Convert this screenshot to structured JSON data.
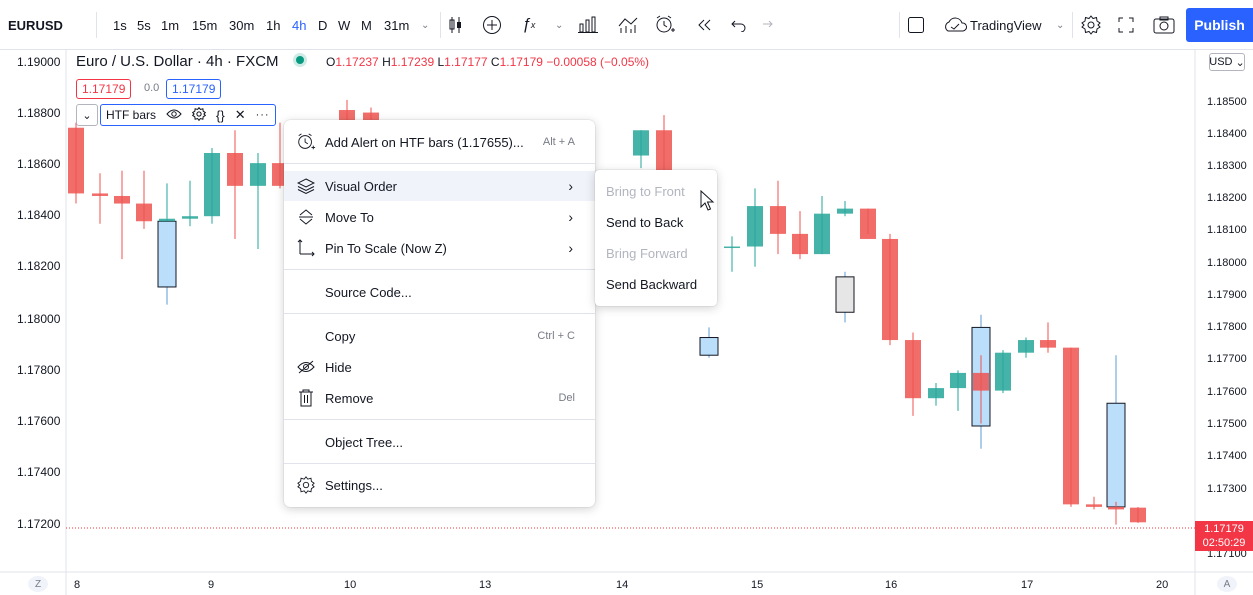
{
  "symbol": "EURUSD",
  "toolbar": {
    "intervals": [
      "1s",
      "5s",
      "1m",
      "15m",
      "30m",
      "1h",
      "4h",
      "D",
      "W",
      "M",
      "31m"
    ],
    "active_interval": "4h",
    "layout_name": "TradingView",
    "publish_label": "Publish"
  },
  "legend": {
    "title": "Euro / U.S. Dollar · 4h · FXCM",
    "open_label": "O",
    "open": "1.17237",
    "high_label": "H",
    "high": "1.17239",
    "low_label": "L",
    "low": "1.17177",
    "close_label": "C",
    "close": "1.17179",
    "change": "−0.00058 (−0.05%)",
    "sell_price": "1.17179",
    "spread": "0.0",
    "buy_price": "1.17179",
    "indicator_name": "HTF bars"
  },
  "left_axis": [
    "1.19000",
    "1.18800",
    "1.18600",
    "1.18400",
    "1.18200",
    "1.18000",
    "1.17800",
    "1.17600",
    "1.17400",
    "1.17200"
  ],
  "right_axis": [
    "1.18500",
    "1.18400",
    "1.18300",
    "1.18200",
    "1.18100",
    "1.18000",
    "1.17900",
    "1.17800",
    "1.17700",
    "1.17600",
    "1.17500",
    "1.17400",
    "1.17300",
    "1.17100"
  ],
  "right_axis_currency": "USD",
  "current_price": {
    "value": "1.17179",
    "countdown": "02:50:29"
  },
  "x_axis": [
    "8",
    "9",
    "10",
    "13",
    "14",
    "15",
    "16",
    "17",
    "20"
  ],
  "corner_left": "Z",
  "corner_right": "A",
  "context_menu": {
    "items": [
      {
        "icon": "add-alert-icon",
        "label": "Add Alert on HTF bars (1.17655)...",
        "shortcut": "Alt + A"
      },
      {
        "icon": "layers-icon",
        "label": "Visual Order",
        "submenu": true
      },
      {
        "icon": "move-to-icon",
        "label": "Move To",
        "submenu": true
      },
      {
        "icon": "pin-scale-icon",
        "label": "Pin To Scale (Now Z)",
        "submenu": true
      },
      {
        "label": "Source Code..."
      },
      {
        "label": "Copy",
        "shortcut": "Ctrl + C"
      },
      {
        "icon": "hide-icon",
        "label": "Hide"
      },
      {
        "icon": "trash-icon",
        "label": "Remove",
        "shortcut": "Del"
      },
      {
        "label": "Object Tree..."
      },
      {
        "icon": "gear-icon",
        "label": "Settings..."
      }
    ]
  },
  "submenu": {
    "items": [
      {
        "label": "Bring to Front",
        "disabled": true
      },
      {
        "label": "Send to Back",
        "disabled": false
      },
      {
        "label": "Bring Forward",
        "disabled": true
      },
      {
        "label": "Send Backward",
        "disabled": false
      }
    ]
  },
  "colors": {
    "up": "#26a69a",
    "down": "#ef5350",
    "htf": "#bbdefb",
    "accent": "#2962ff"
  },
  "chart_data": {
    "type": "candlestick",
    "timeframe": "4h",
    "candles": [
      {
        "o": 1.1874,
        "h": 1.1876,
        "l": 1.1844,
        "c": 1.1848
      },
      {
        "o": 1.1848,
        "h": 1.1856,
        "l": 1.1836,
        "c": 1.1847
      },
      {
        "o": 1.1847,
        "h": 1.1857,
        "l": 1.1822,
        "c": 1.1844
      },
      {
        "o": 1.1844,
        "h": 1.1857,
        "l": 1.1834,
        "c": 1.1837
      },
      {
        "o": 1.1837,
        "h": 1.1852,
        "l": 1.1838,
        "c": 1.1838
      },
      {
        "o": 1.1838,
        "h": 1.1853,
        "l": 1.1835,
        "c": 1.1839
      },
      {
        "o": 1.1839,
        "h": 1.1866,
        "l": 1.1836,
        "c": 1.1864
      },
      {
        "o": 1.1864,
        "h": 1.1873,
        "l": 1.183,
        "c": 1.1851
      },
      {
        "o": 1.1851,
        "h": 1.1864,
        "l": 1.1826,
        "c": 1.186
      },
      {
        "o": 1.186,
        "h": 1.1876,
        "l": 1.185,
        "c": 1.1851
      },
      {
        "o": 1.1881,
        "h": 1.1885,
        "l": 1.187,
        "c": 1.187
      },
      {
        "o": 1.188,
        "h": 1.1882,
        "l": 1.187,
        "c": 1.1876
      },
      {
        "o": 1.1863,
        "h": 1.1873,
        "l": 1.1858,
        "c": 1.1873
      },
      {
        "o": 1.1873,
        "h": 1.1879,
        "l": 1.1856,
        "c": 1.1857
      },
      {
        "o": 1.1824,
        "h": 1.1829,
        "l": 1.1822,
        "c": 1.1827
      },
      {
        "o": 1.1827,
        "h": 1.1831,
        "l": 1.1817,
        "c": 1.1827
      },
      {
        "o": 1.1827,
        "h": 1.185,
        "l": 1.1819,
        "c": 1.1843
      },
      {
        "o": 1.1843,
        "h": 1.1853,
        "l": 1.1824,
        "c": 1.1832
      },
      {
        "o": 1.1832,
        "h": 1.1841,
        "l": 1.1822,
        "c": 1.1824
      },
      {
        "o": 1.1824,
        "h": 1.1847,
        "l": 1.1824,
        "c": 1.184
      },
      {
        "o": 1.184,
        "h": 1.1845,
        "l": 1.1839,
        "c": 1.1842
      },
      {
        "o": 1.1842,
        "h": 1.1842,
        "l": 1.1832,
        "c": 1.183
      },
      {
        "o": 1.183,
        "h": 1.1832,
        "l": 1.1788,
        "c": 1.179
      },
      {
        "o": 1.179,
        "h": 1.1793,
        "l": 1.176,
        "c": 1.1767
      },
      {
        "o": 1.1767,
        "h": 1.1773,
        "l": 1.1764,
        "c": 1.1771
      },
      {
        "o": 1.1771,
        "h": 1.1778,
        "l": 1.1762,
        "c": 1.1777
      },
      {
        "o": 1.1777,
        "h": 1.1784,
        "l": 1.1757,
        "c": 1.177
      },
      {
        "o": 1.177,
        "h": 1.1786,
        "l": 1.1769,
        "c": 1.1785
      },
      {
        "o": 1.1785,
        "h": 1.1791,
        "l": 1.1783,
        "c": 1.179
      },
      {
        "o": 1.179,
        "h": 1.1797,
        "l": 1.1785,
        "c": 1.1787
      },
      {
        "o": 1.1787,
        "h": 1.1787,
        "l": 1.1724,
        "c": 1.1725
      },
      {
        "o": 1.1725,
        "h": 1.1728,
        "l": 1.1723,
        "c": 1.1724
      },
      {
        "o": 1.1724,
        "h": 1.1726,
        "l": 1.1717,
        "c": 1.1723
      },
      {
        "o": 1.17237,
        "h": 1.17239,
        "l": 1.17177,
        "c": 1.17179
      }
    ],
    "htf_bars": [
      {
        "o": 1.1837,
        "h": 1.1838,
        "l": 1.1804,
        "c": 1.1811
      },
      {
        "o": 1.1791,
        "h": 1.1795,
        "l": 1.1783,
        "c": 1.1784
      },
      {
        "o": 1.1815,
        "h": 1.1817,
        "l": 1.1797,
        "c": 1.1801
      },
      {
        "o": 1.1756,
        "h": 1.18,
        "l": 1.1747,
        "c": 1.1795
      },
      {
        "o": 1.1765,
        "h": 1.1784,
        "l": 1.1724,
        "c": 1.1724
      }
    ]
  }
}
